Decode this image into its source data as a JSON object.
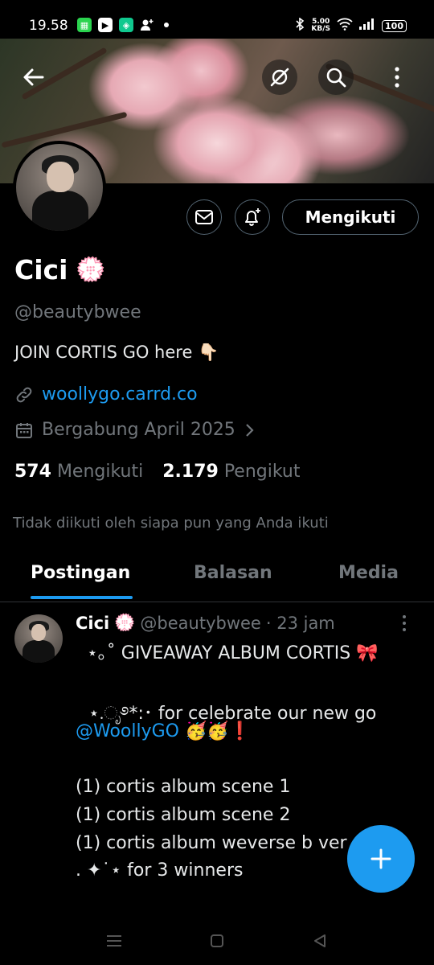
{
  "status_bar": {
    "time": "19.58",
    "net_speed_value": "5.00",
    "net_speed_unit": "KB/S",
    "battery": "100"
  },
  "profile": {
    "name": "Cici",
    "name_emoji": "💮",
    "handle": "@beautybwee",
    "bio": "JOIN CORTIS GO here 👇🏻",
    "link": "woollygo.carrd.co",
    "joined": "Bergabung April 2025",
    "following_count": "574",
    "following_label": "Mengikuti",
    "followers_count": "2.179",
    "followers_label": "Pengikut",
    "not_followed_note": "Tidak diikuti oleh siapa pun yang Anda ikuti",
    "follow_button_label": "Mengikuti"
  },
  "tabs": [
    {
      "label": "Postingan",
      "active": true
    },
    {
      "label": "Balasan",
      "active": false
    },
    {
      "label": "Media",
      "active": false
    }
  ],
  "post": {
    "author_name": "Cici",
    "author_emoji": "💮",
    "handle": "@beautybwee",
    "time": "· 23 jam",
    "lines": [
      "⋆｡˚ GIVEAWAY ALBUM CORTIS 🎀",
      "⋆.ೃ࿔*:･ for celebrate our new go",
      "",
      "(1) cortis album scene 1",
      "(1) cortis album scene 2",
      "(1) cortis album weverse b ver",
      ". ✦˙⋆ for 3 winners"
    ],
    "mention": "@WoollyGO",
    "mention_suffix": "🥳🥳❗"
  },
  "colors": {
    "accent": "#1d9bf0",
    "background": "#000000",
    "muted_text": "#71767b",
    "border": "#536471"
  },
  "icons": [
    "back-arrow-icon",
    "grok-icon",
    "search-icon",
    "more-vertical-icon",
    "mail-icon",
    "bell-plus-icon",
    "link-icon",
    "calendar-icon",
    "chevron-right-icon",
    "plus-icon"
  ]
}
